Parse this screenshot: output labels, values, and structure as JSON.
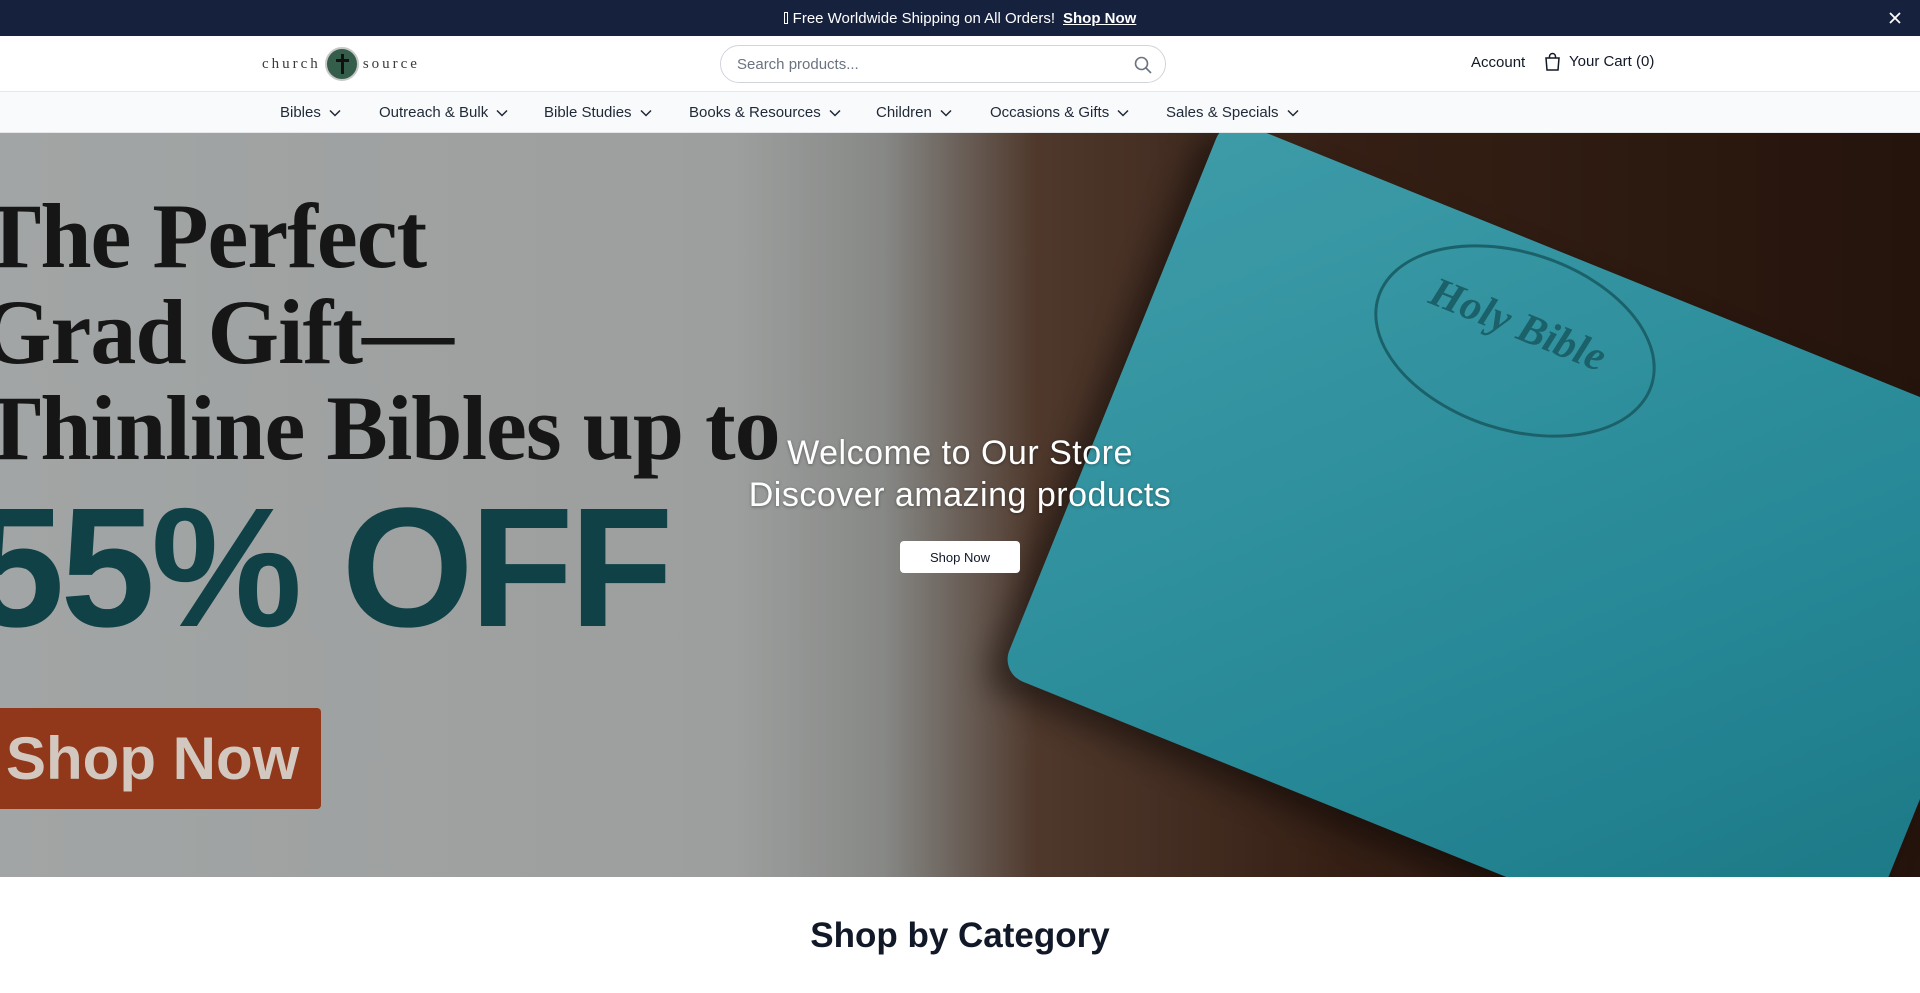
{
  "announcement": {
    "message": "Free Worldwide Shipping on All Orders!",
    "link_label": "Shop Now",
    "background": "#16213e"
  },
  "header": {
    "logo_text_left": "church",
    "logo_text_right": "source",
    "search": {
      "placeholder": "Search products...",
      "value": ""
    },
    "account_label": "Account",
    "cart_label": "Your Cart (0)"
  },
  "nav": {
    "items": [
      {
        "label": "Bibles"
      },
      {
        "label": "Outreach & Bulk"
      },
      {
        "label": "Bible Studies"
      },
      {
        "label": "Books & Resources"
      },
      {
        "label": "Children"
      },
      {
        "label": "Occasions & Gifts"
      },
      {
        "label": "Sales & Specials"
      }
    ]
  },
  "hero": {
    "ad_line1": "The Perfect",
    "ad_line2": "Grad Gift—",
    "ad_line3": "Thinline Bibles up to",
    "ad_discount": "55% OFF",
    "ad_button": "Shop Now",
    "book_cover_text": "Holy Bible",
    "title": "Welcome to Our Store",
    "subtitle": "Discover amazing products",
    "button_label": "Shop Now"
  },
  "sections": {
    "category_title": "Shop by Category"
  },
  "colors": {
    "accent": "#16213e",
    "ad_discount": "#124b50",
    "ad_button": "#a4401d",
    "book": "#2c9bab"
  }
}
